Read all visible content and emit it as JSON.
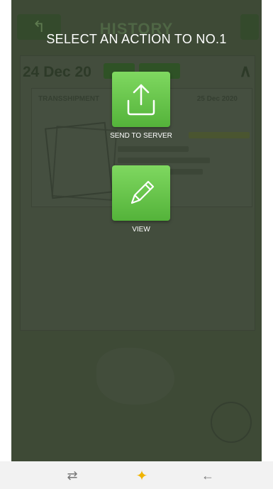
{
  "header": {
    "title": "HISTORY"
  },
  "overlay": {
    "title": "SELECT AN ACTION TO NO.1",
    "actions": [
      {
        "label": "SEND TO SERVER",
        "icon": "upload-icon"
      },
      {
        "label": "VIEW",
        "icon": "pencil-icon"
      }
    ]
  },
  "background": {
    "group_date": "24 Dec 20",
    "card_type": "TRANSSHIPMENT",
    "card_date": "25 Dec 2020"
  },
  "navbar": {
    "buttons": [
      {
        "glyph": "⇄",
        "icon": "recent-apps-icon"
      },
      {
        "glyph": "✦",
        "icon": "home-icon"
      },
      {
        "glyph": "←",
        "icon": "back-icon"
      }
    ]
  },
  "colors": {
    "accent": "#6cc94f",
    "scrim": "#3e4a36",
    "navbar": "#f2f2f2"
  }
}
